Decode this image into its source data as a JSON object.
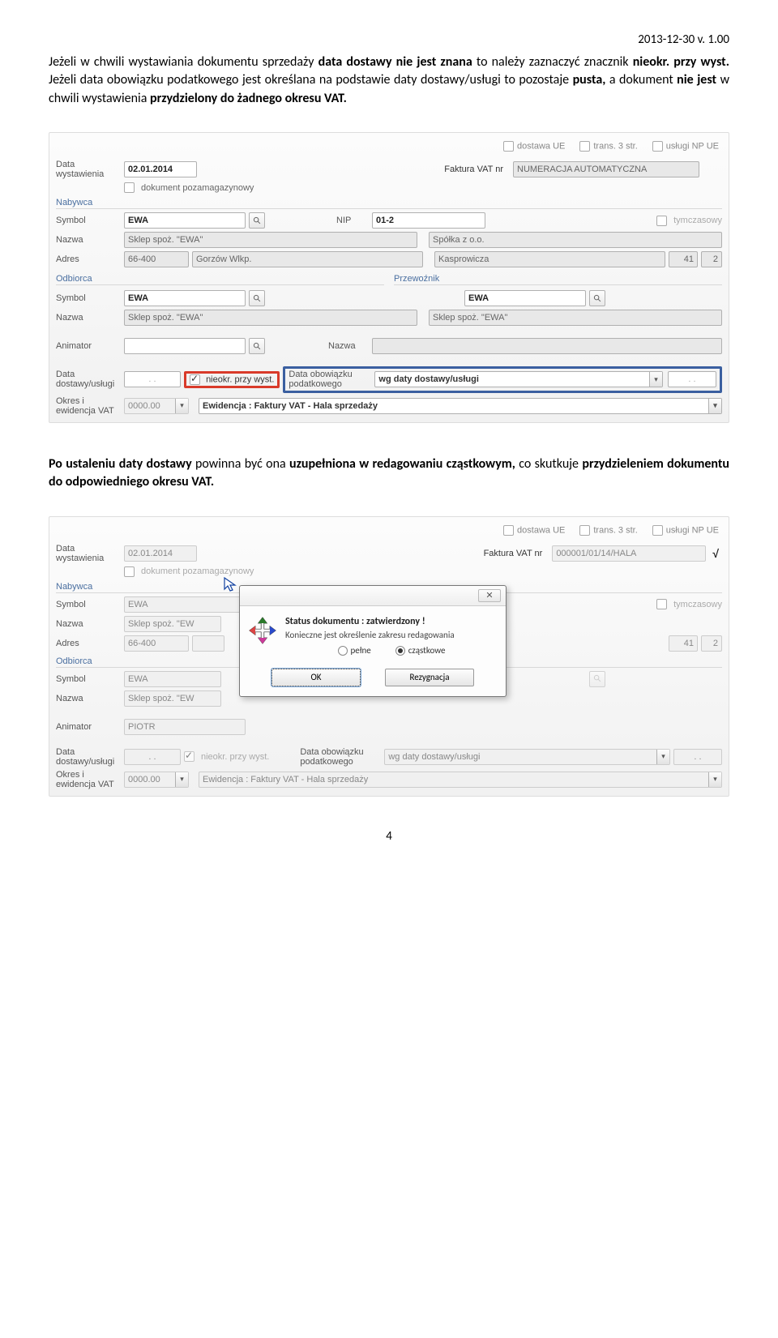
{
  "version": "2013-12-30 v. 1.00",
  "para1_a": "Jeżeli w chwili wystawiania dokumentu sprzedaży ",
  "para1_b": "data dostawy nie jest znana",
  "para1_c": " to należy zaznaczyć znacznik ",
  "para1_d": "nieokr. przy wyst.",
  "para1_e": " Jeżeli data obowiązku podatkowego jest określana na podstawie daty dostawy/usługi to pozostaje ",
  "para1_f": "pusta,",
  "para1_g": " a dokument ",
  "para1_h": "nie jest",
  "para1_i": " w chwili wystawienia ",
  "para1_j": "przydzielony do żadnego okresu VAT.",
  "flags": {
    "f1": "dostawa UE",
    "f2": "trans. 3 str.",
    "f3": "usługi NP UE"
  },
  "labels": {
    "data_wyst": "Data wystawienia",
    "faktura": "Faktura VAT nr",
    "dok_poza": "dokument pozamagazynowy",
    "nabywca": "Nabywca",
    "symbol": "Symbol",
    "nip": "NIP",
    "tymczasowy": "tymczasowy",
    "nazwa": "Nazwa",
    "adres": "Adres",
    "odbiorca": "Odbiorca",
    "przewoznik": "Przewoźnik",
    "animator": "Animator",
    "data_dost": "Data dostawy/usługi",
    "nieokr": "nieokr. przy wyst.",
    "data_obow": "Data obowiązku podatkowego",
    "okres": "Okres i ewidencja VAT"
  },
  "vals": {
    "date": "02.01.2014",
    "faktura_auto": "NUMERACJA AUTOMATYCZNA",
    "faktura_num": "000001/01/14/HALA",
    "ewa": "EWA",
    "nip": "01-2",
    "sklep": "Sklep spoż. \"EWA\"",
    "sklep_short": "Sklep spoż. \"EW",
    "spolka": "Spółka z o.o.",
    "kod": "66-400",
    "miasto": "Gorzów Wlkp.",
    "ulica": "Kasprowicza",
    "nr1": "41",
    "nr2": "2",
    "wgdaty": "wg daty dostawy/usługi",
    "okres_val": "0000.00",
    "ewidencja": "Ewidencja : Faktury VAT - Hala sprzedaży",
    "dash": ". .",
    "piotr": "PIOTR"
  },
  "para2_a": "Po ustaleniu daty dostawy",
  "para2_b": " powinna być ona ",
  "para2_c": "uzupełniona w redagowaniu cząstkowym,",
  "para2_d": " co skutkuje ",
  "para2_e": "przydzieleniem dokumentu do odpowiedniego okresu VAT.",
  "dialog": {
    "close": "✕",
    "status": "Status dokumentu : zatwierdzony !",
    "sub": "Konieczne jest określenie zakresu redagowania",
    "r1": "pełne",
    "r2": "cząstkowe",
    "ok": "OK",
    "cancel": "Rezygnacja"
  },
  "page": "4"
}
